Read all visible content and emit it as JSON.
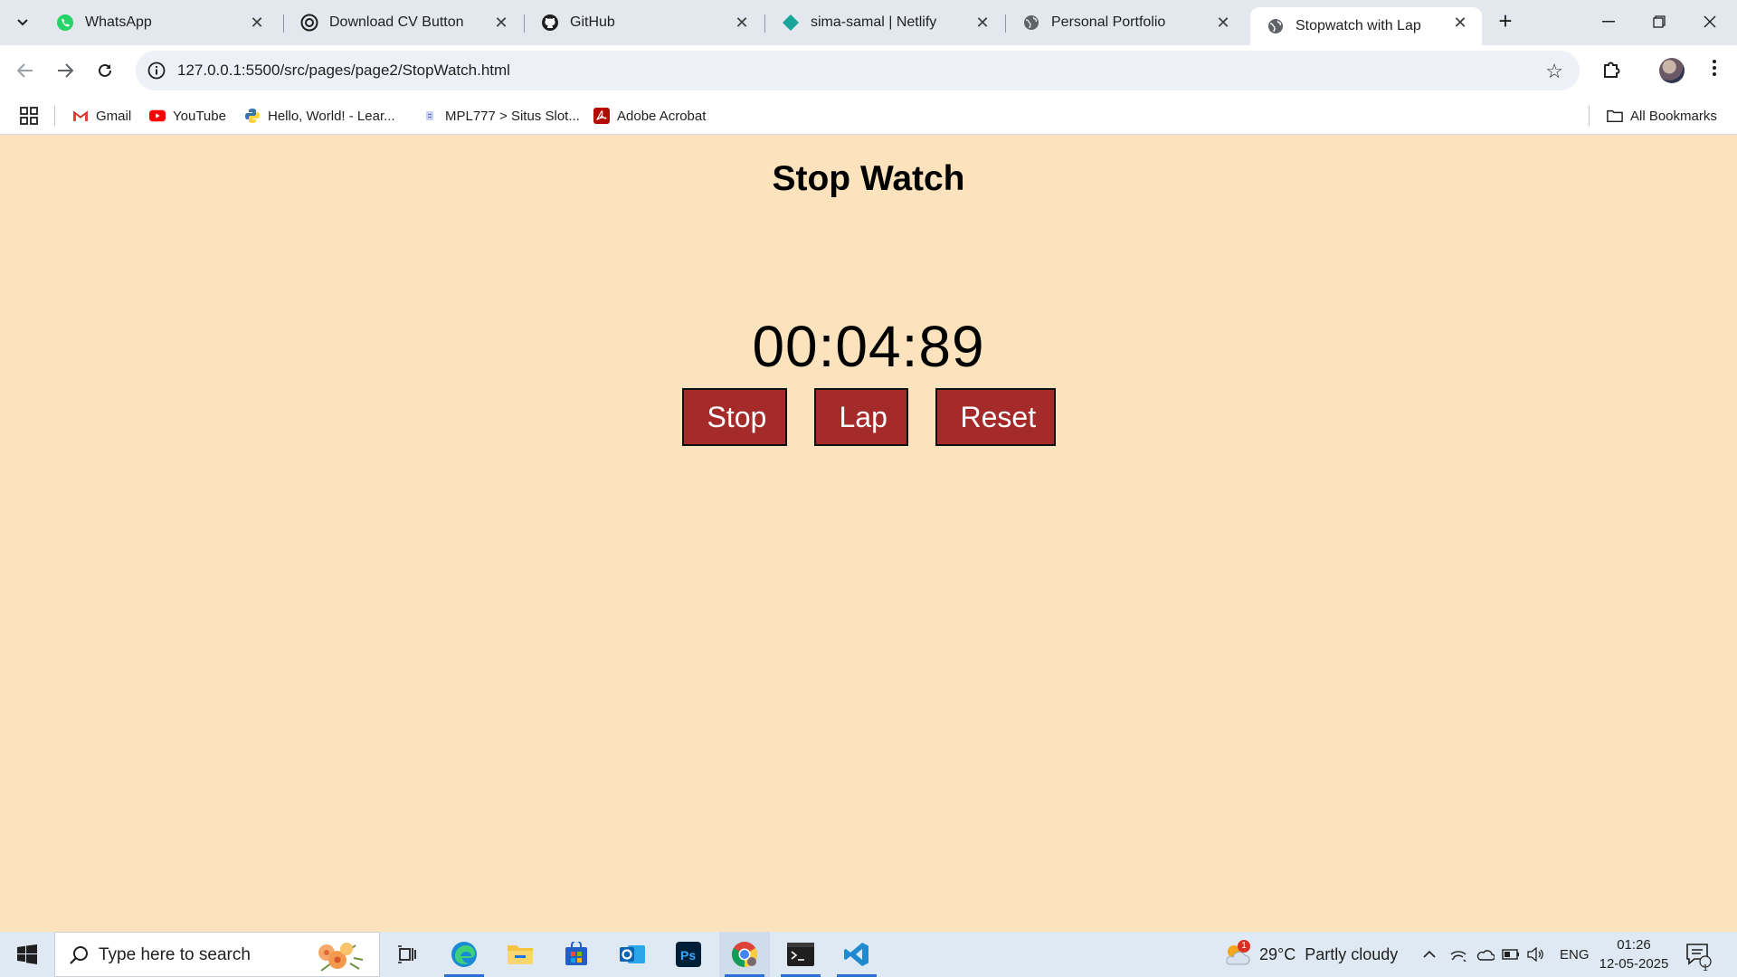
{
  "browser": {
    "tabs": [
      {
        "title": "WhatsApp",
        "icon": "whatsapp-icon"
      },
      {
        "title": "Download CV Button",
        "icon": "openai-icon"
      },
      {
        "title": "GitHub",
        "icon": "github-icon"
      },
      {
        "title": "sima-samal | Netlify",
        "icon": "netlify-icon"
      },
      {
        "title": "Personal Portfolio",
        "icon": "globe-icon"
      },
      {
        "title": "Stopwatch with Lap",
        "icon": "globe-icon",
        "active": true
      }
    ],
    "url": "127.0.0.1:5500/src/pages/page2/StopWatch.html",
    "bookmarks": [
      {
        "label": "Gmail",
        "icon": "gmail-icon"
      },
      {
        "label": "YouTube",
        "icon": "youtube-icon"
      },
      {
        "label": "Hello, World! - Lear...",
        "icon": "python-icon"
      },
      {
        "label": "MPL777 > Situs Slot...",
        "icon": "site-icon"
      },
      {
        "label": "Adobe Acrobat",
        "icon": "acrobat-icon"
      }
    ],
    "all_bookmarks_label": "All Bookmarks"
  },
  "page": {
    "title": "Stop Watch",
    "timer": "00:04:89",
    "buttons": {
      "stop": "Stop",
      "lap": "Lap",
      "reset": "Reset"
    }
  },
  "taskbar": {
    "search_placeholder": "Type here to search",
    "weather": {
      "temp": "29°C",
      "condition": "Partly cloudy",
      "badge": "1"
    },
    "language": "ENG",
    "time": "01:26",
    "date": "12-05-2025",
    "notification_count": "1"
  },
  "colors": {
    "page_bg": "#fde3bd",
    "button_bg": "#a52a2a",
    "button_text": "#ffffff"
  }
}
